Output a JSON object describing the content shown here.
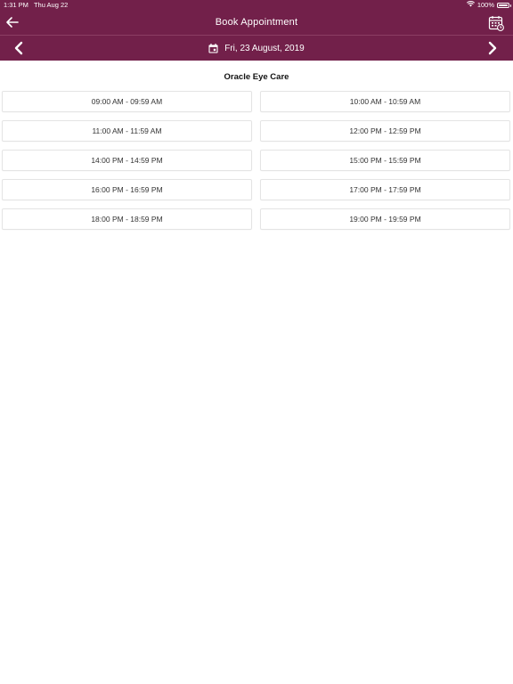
{
  "status_bar": {
    "time": "1:31 PM",
    "date": "Thu Aug 22",
    "battery": "100%",
    "battery_level": 1.0,
    "wifi_icon": "wifi-icon"
  },
  "header": {
    "title": "Book Appointment",
    "back_icon": "arrow-left-icon",
    "calendar_icon": "calendar-icon"
  },
  "date_nav": {
    "date_label": "Fri, 23 August, 2019",
    "prev_icon": "chevron-left-icon",
    "next_icon": "chevron-right-icon",
    "date_icon": "calendar-small-icon"
  },
  "clinic": {
    "name": "Oracle Eye Care"
  },
  "slots": [
    "09:00 AM - 09:59 AM",
    "10:00 AM - 10:59 AM",
    "11:00 AM - 11:59 AM",
    "12:00 PM - 12:59 PM",
    "14:00 PM - 14:59 PM",
    "15:00 PM - 15:59 PM",
    "16:00 PM - 16:59 PM",
    "17:00 PM - 17:59 PM",
    "18:00 PM - 18:59 PM",
    "19:00 PM - 19:59 PM"
  ],
  "colors": {
    "header_bg": "#72204a",
    "slot_border": "#e4e4e4",
    "background": "#ffffff"
  }
}
